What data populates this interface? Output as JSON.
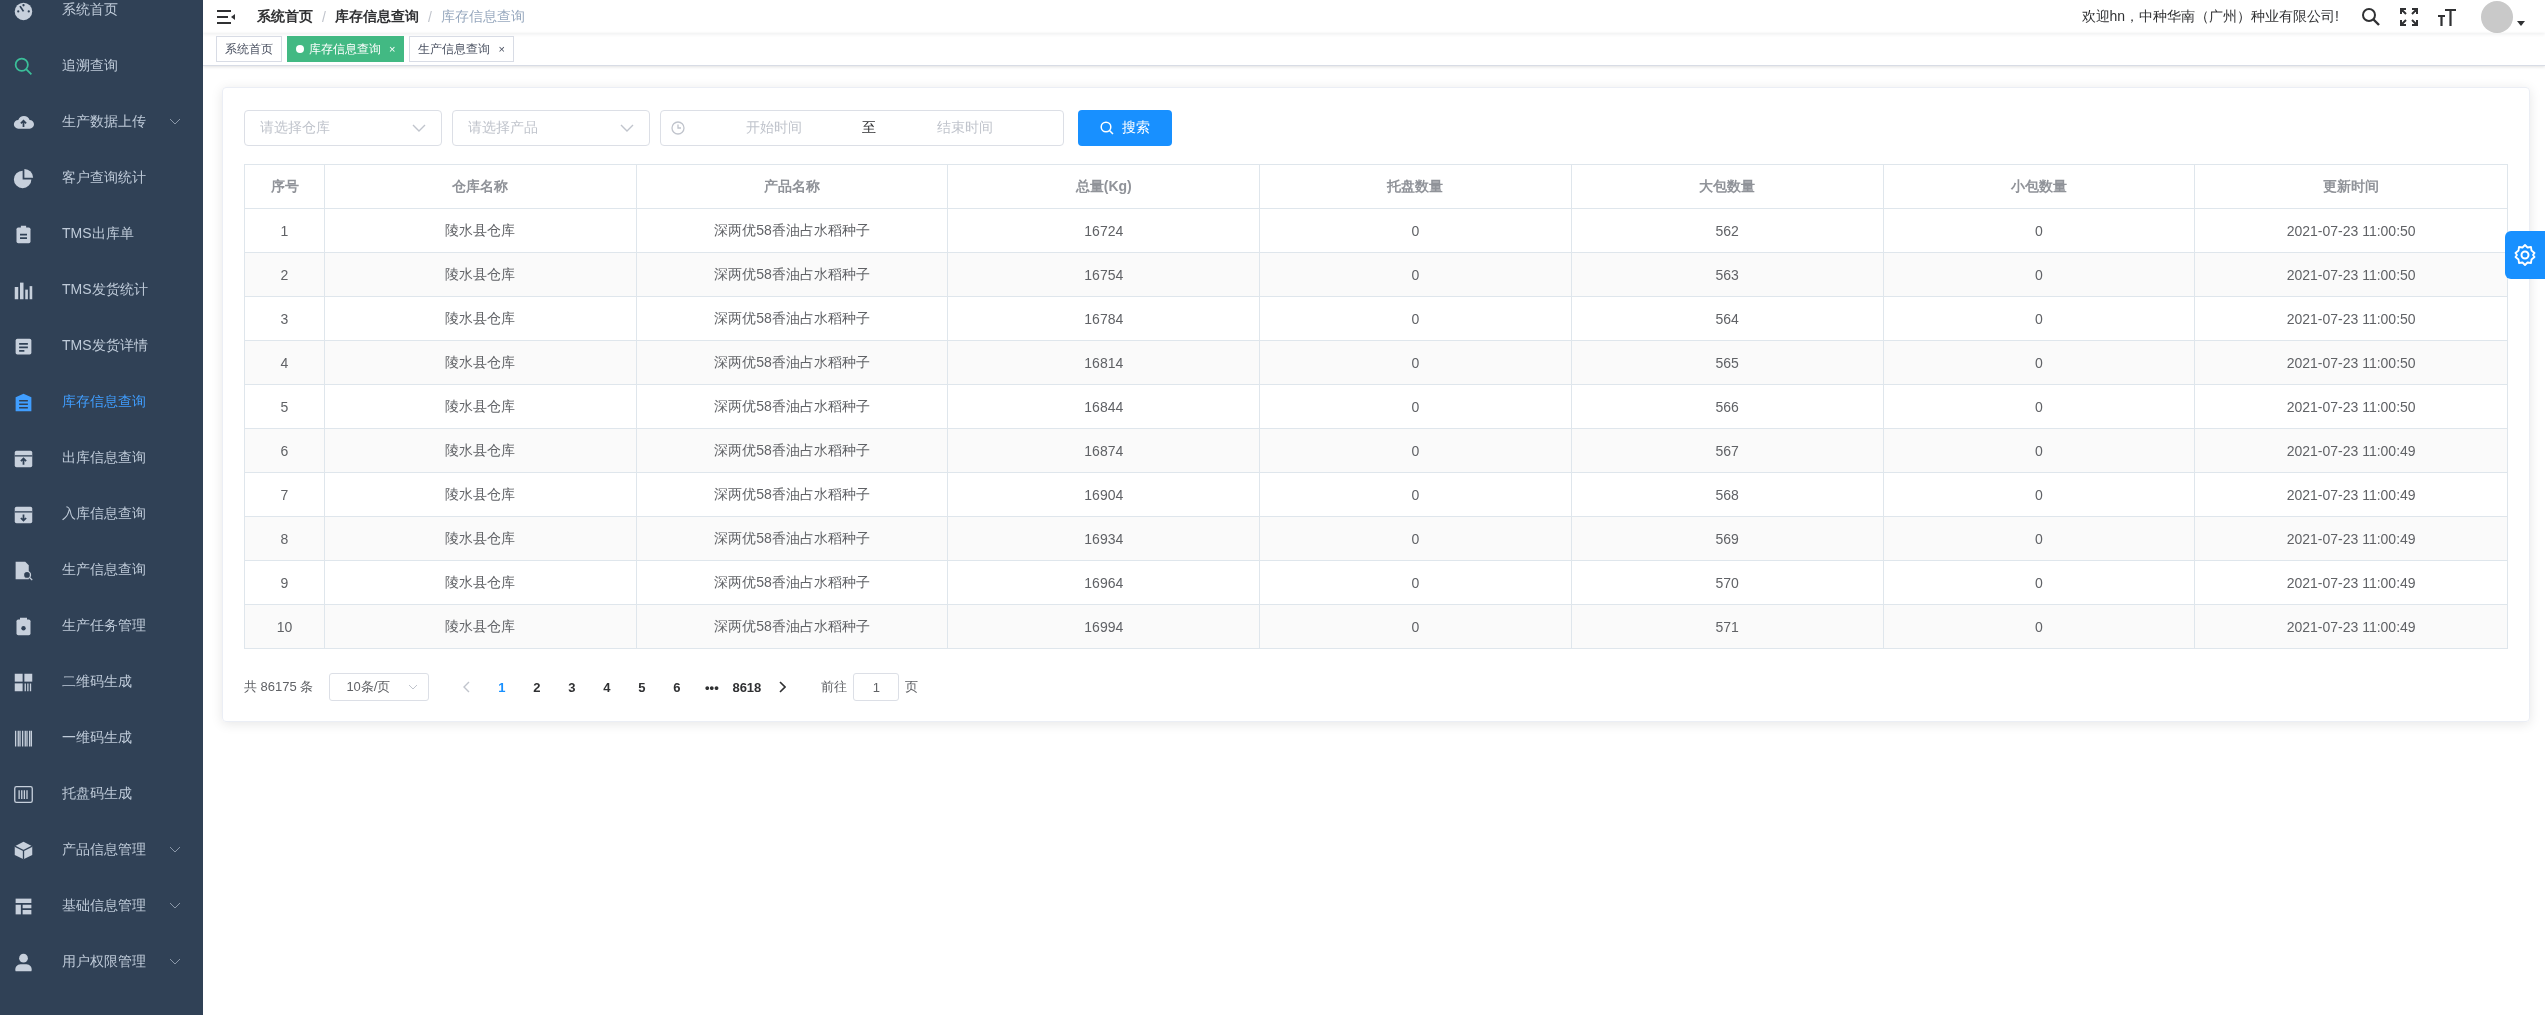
{
  "sidebar": {
    "items": [
      {
        "label": "系统首页",
        "selected": false,
        "expandable": false
      },
      {
        "label": "追溯查询",
        "selected": false,
        "expandable": false
      },
      {
        "label": "生产数据上传",
        "selected": false,
        "expandable": true
      },
      {
        "label": "客户查询统计",
        "selected": false,
        "expandable": false
      },
      {
        "label": "TMS出库单",
        "selected": false,
        "expandable": false
      },
      {
        "label": "TMS发货统计",
        "selected": false,
        "expandable": false
      },
      {
        "label": "TMS发货详情",
        "selected": false,
        "expandable": false
      },
      {
        "label": "库存信息查询",
        "selected": true,
        "expandable": false
      },
      {
        "label": "出库信息查询",
        "selected": false,
        "expandable": false
      },
      {
        "label": "入库信息查询",
        "selected": false,
        "expandable": false
      },
      {
        "label": "生产信息查询",
        "selected": false,
        "expandable": false
      },
      {
        "label": "生产任务管理",
        "selected": false,
        "expandable": false
      },
      {
        "label": "二维码生成",
        "selected": false,
        "expandable": false
      },
      {
        "label": "一维码生成",
        "selected": false,
        "expandable": false
      },
      {
        "label": "托盘码生成",
        "selected": false,
        "expandable": false
      },
      {
        "label": "产品信息管理",
        "selected": false,
        "expandable": true
      },
      {
        "label": "基础信息管理",
        "selected": false,
        "expandable": true
      },
      {
        "label": "用户权限管理",
        "selected": false,
        "expandable": true
      }
    ]
  },
  "breadcrumb": [
    "系统首页",
    "库存信息查询",
    "库存信息查询"
  ],
  "breadcrumb_separator": "/",
  "welcome": "欢迎hn，中种华南（广州）种业有限公司!",
  "tabs": [
    {
      "label": "系统首页",
      "selected": false,
      "closable": false
    },
    {
      "label": "库存信息查询",
      "selected": true,
      "closable": true
    },
    {
      "label": "生产信息查询",
      "selected": false,
      "closable": true
    }
  ],
  "close_glyph": "×",
  "filters": {
    "warehouse": {
      "placeholder": "请选择仓库"
    },
    "product": {
      "placeholder": "请选择产品"
    },
    "start": {
      "placeholder": "开始时间"
    },
    "range_separator": "至",
    "end": {
      "placeholder": "结束时间"
    },
    "search_button": "搜索"
  },
  "table": {
    "columns": [
      "序号",
      "仓库名称",
      "产品名称",
      "总量(Kg)",
      "托盘数量",
      "大包数量",
      "小包数量",
      "更新时间"
    ],
    "rows": [
      [
        "1",
        "陵水县仓库",
        "深两优58香油占水稻种子",
        "16724",
        "0",
        "562",
        "0",
        "2021-07-23 11:00:50"
      ],
      [
        "2",
        "陵水县仓库",
        "深两优58香油占水稻种子",
        "16754",
        "0",
        "563",
        "0",
        "2021-07-23 11:00:50"
      ],
      [
        "3",
        "陵水县仓库",
        "深两优58香油占水稻种子",
        "16784",
        "0",
        "564",
        "0",
        "2021-07-23 11:00:50"
      ],
      [
        "4",
        "陵水县仓库",
        "深两优58香油占水稻种子",
        "16814",
        "0",
        "565",
        "0",
        "2021-07-23 11:00:50"
      ],
      [
        "5",
        "陵水县仓库",
        "深两优58香油占水稻种子",
        "16844",
        "0",
        "566",
        "0",
        "2021-07-23 11:00:50"
      ],
      [
        "6",
        "陵水县仓库",
        "深两优58香油占水稻种子",
        "16874",
        "0",
        "567",
        "0",
        "2021-07-23 11:00:49"
      ],
      [
        "7",
        "陵水县仓库",
        "深两优58香油占水稻种子",
        "16904",
        "0",
        "568",
        "0",
        "2021-07-23 11:00:49"
      ],
      [
        "8",
        "陵水县仓库",
        "深两优58香油占水稻种子",
        "16934",
        "0",
        "569",
        "0",
        "2021-07-23 11:00:49"
      ],
      [
        "9",
        "陵水县仓库",
        "深两优58香油占水稻种子",
        "16964",
        "0",
        "570",
        "0",
        "2021-07-23 11:00:49"
      ],
      [
        "10",
        "陵水县仓库",
        "深两优58香油占水稻种子",
        "16994",
        "0",
        "571",
        "0",
        "2021-07-23 11:00:49"
      ]
    ]
  },
  "pagination": {
    "total": "共 86175 条",
    "page_size": "10条/页",
    "pages": [
      {
        "label": "1",
        "selected": true
      },
      {
        "label": "2",
        "selected": false
      },
      {
        "label": "3",
        "selected": false
      },
      {
        "label": "4",
        "selected": false
      },
      {
        "label": "5",
        "selected": false
      },
      {
        "label": "6",
        "selected": false
      },
      {
        "label": "8618",
        "selected": false
      }
    ],
    "ellipsis": "•••",
    "goto_label": "前往",
    "goto_value": "1",
    "page_unit": "页"
  }
}
